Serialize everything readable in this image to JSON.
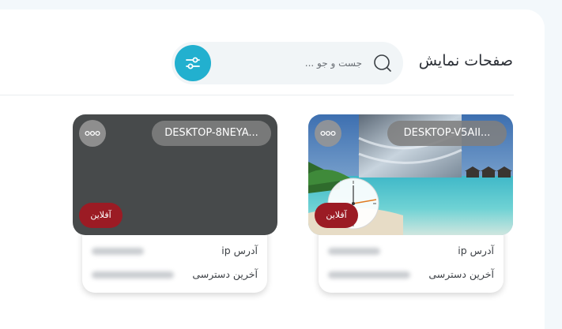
{
  "header": {
    "title": "صفحات نمایش",
    "search_placeholder": "جست و جو ..."
  },
  "colors": {
    "accent": "#22b0cf",
    "offline_badge": "#9b1b24",
    "card_dark": "#474a4b"
  },
  "devices": [
    {
      "name": "DESKTOP-V5AII...",
      "status": "آفلاین",
      "ip_label": "آدرس ip",
      "last_access_label": "آخرین دسترسی",
      "thumbnail": "beach-clock-wallpaper"
    },
    {
      "name": "DESKTOP-8NEYA...",
      "status": "آفلاین",
      "ip_label": "آدرس ip",
      "last_access_label": "آخرین دسترسی",
      "thumbnail": "blank-dark"
    }
  ]
}
